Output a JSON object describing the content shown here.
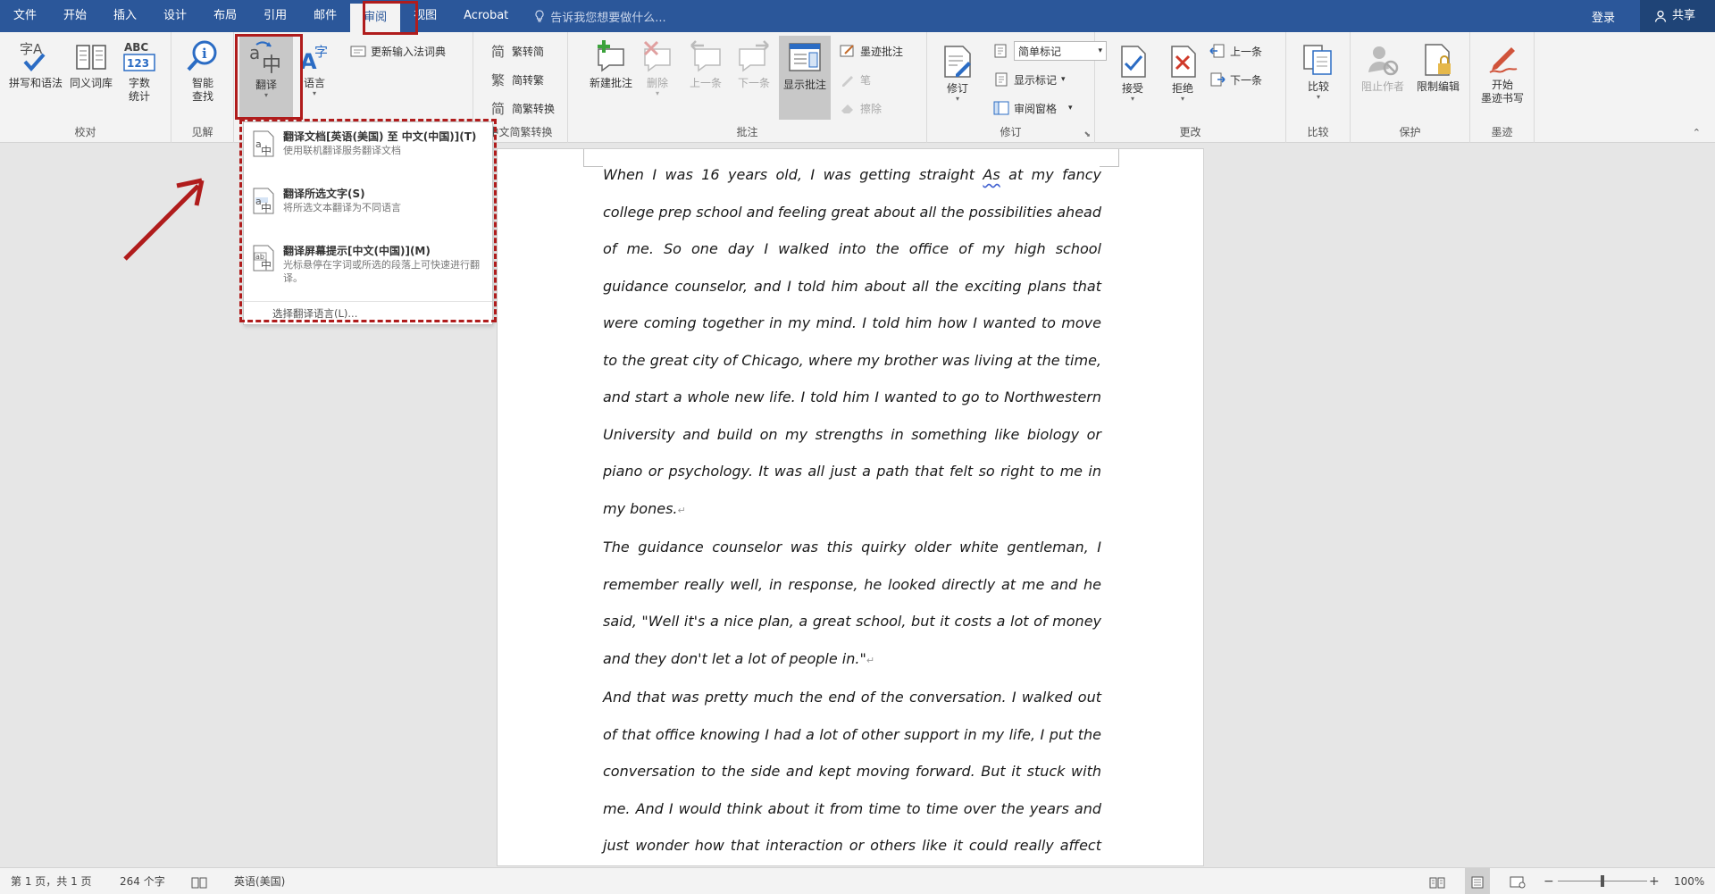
{
  "tabs": [
    "文件",
    "开始",
    "插入",
    "设计",
    "布局",
    "引用",
    "邮件",
    "审阅",
    "视图",
    "Acrobat"
  ],
  "active_tab": "审阅",
  "tell_me": "告诉我您想要做什么...",
  "login": "登录",
  "share": "共享",
  "groups": {
    "proofing": {
      "label": "校对",
      "spelling": "拼写和语法",
      "thesaurus": "同义词库",
      "wordcount": "字数\n统计"
    },
    "insights": {
      "label": "见解",
      "smart_lookup": "智能\n查找"
    },
    "language": {
      "translate": "翻译",
      "language": "语言",
      "update_ime": "更新输入法词典"
    },
    "chinese": {
      "label": "中文简繁转换",
      "to_simplified": "繁转简",
      "to_traditional": "简转繁",
      "convert": "简繁转换"
    },
    "comments": {
      "label": "批注",
      "new": "新建批注",
      "delete": "删除",
      "prev": "上一条",
      "next": "下一条",
      "show": "显示批注",
      "ink_comment": "墨迹批注",
      "pen": "笔",
      "erase": "擦除"
    },
    "tracking": {
      "label": "修订",
      "track": "修订",
      "simple_markup": "简单标记",
      "show_markup": "显示标记",
      "review_pane": "审阅窗格"
    },
    "changes": {
      "label": "更改",
      "accept": "接受",
      "reject": "拒绝",
      "previous": "上一条",
      "next": "下一条"
    },
    "compare": {
      "label": "比较",
      "compare": "比较"
    },
    "protect": {
      "label": "保护",
      "block_authors": "阻止作者",
      "restrict": "限制编辑"
    },
    "ink": {
      "label": "墨迹",
      "start_inking": "开始\n墨迹书写"
    }
  },
  "translate_menu": {
    "items": [
      {
        "title": "翻译文档[英语(美国) 至 中文(中国)](T)",
        "desc": "使用联机翻译服务翻译文档"
      },
      {
        "title": "翻译所选文字(S)",
        "desc": "将所选文本翻译为不同语言"
      },
      {
        "title": "翻译屏幕提示[中文(中国)](M)",
        "desc": "光标悬停在字词或所选的段落上可快速进行翻译。"
      }
    ],
    "footer": "选择翻译语言(L)..."
  },
  "document": {
    "p1_a": "When I was 16 years old, I was getting straight ",
    "p1_as": "As",
    "p1_b": " at my fancy college prep school and feeling great about all the possibilities ahead of me. So one day I walked into the office of my high school guidance counselor, and I told him about all the exciting plans that were coming together in my mind. I told him how I wanted to move to the great city of Chicago, where my brother was living at the time, and start a whole new life. I told him I wanted to go to Northwestern University and build on my strengths in something like biology or piano or psychology. It was all just a path that felt so right to me in my bones.",
    "p2": "The guidance counselor was this quirky older white gentleman, I remember really well, in response, he looked directly at me and he said, \"Well it's a nice plan, a great school, but it costs a lot of money and they don't let a lot of people in.\"",
    "p3": "And that was pretty much the end of the conversation. I walked out of that office knowing I had a lot of other support in my life, I put the conversation to the side and kept moving forward. But it stuck with me. And I would think about it from time to time over the years and just wonder how that interaction or others like it could really affect someone, especially if they don't have a lot of other support in their life or"
  },
  "status": {
    "page": "第 1 页，共 1 页",
    "words": "264 个字",
    "language": "英语(美国)",
    "zoom": "100%",
    "zoom_level": 1.0
  }
}
